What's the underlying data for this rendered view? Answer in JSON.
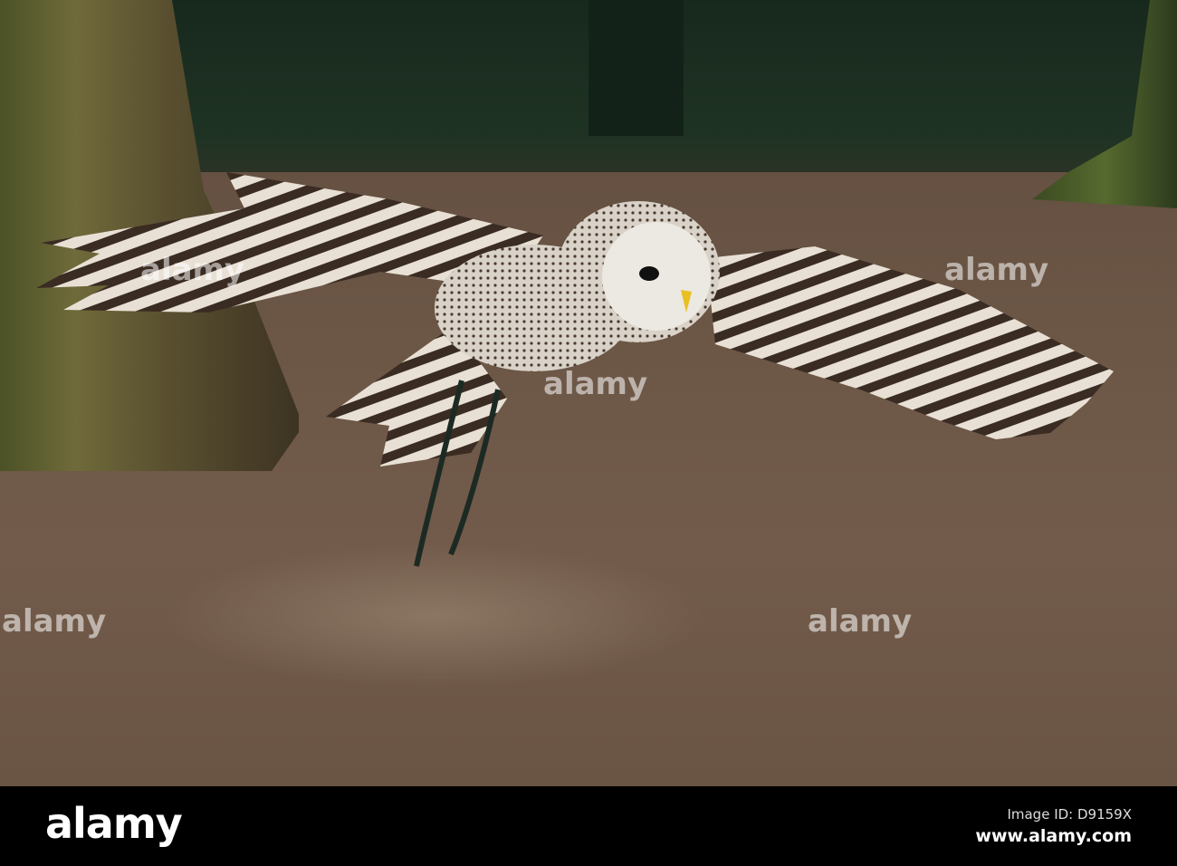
{
  "watermark": {
    "text": "alamy"
  },
  "footer": {
    "logo": "alamy",
    "image_id": "Image ID: D9159X",
    "website": "www.alamy.com"
  }
}
